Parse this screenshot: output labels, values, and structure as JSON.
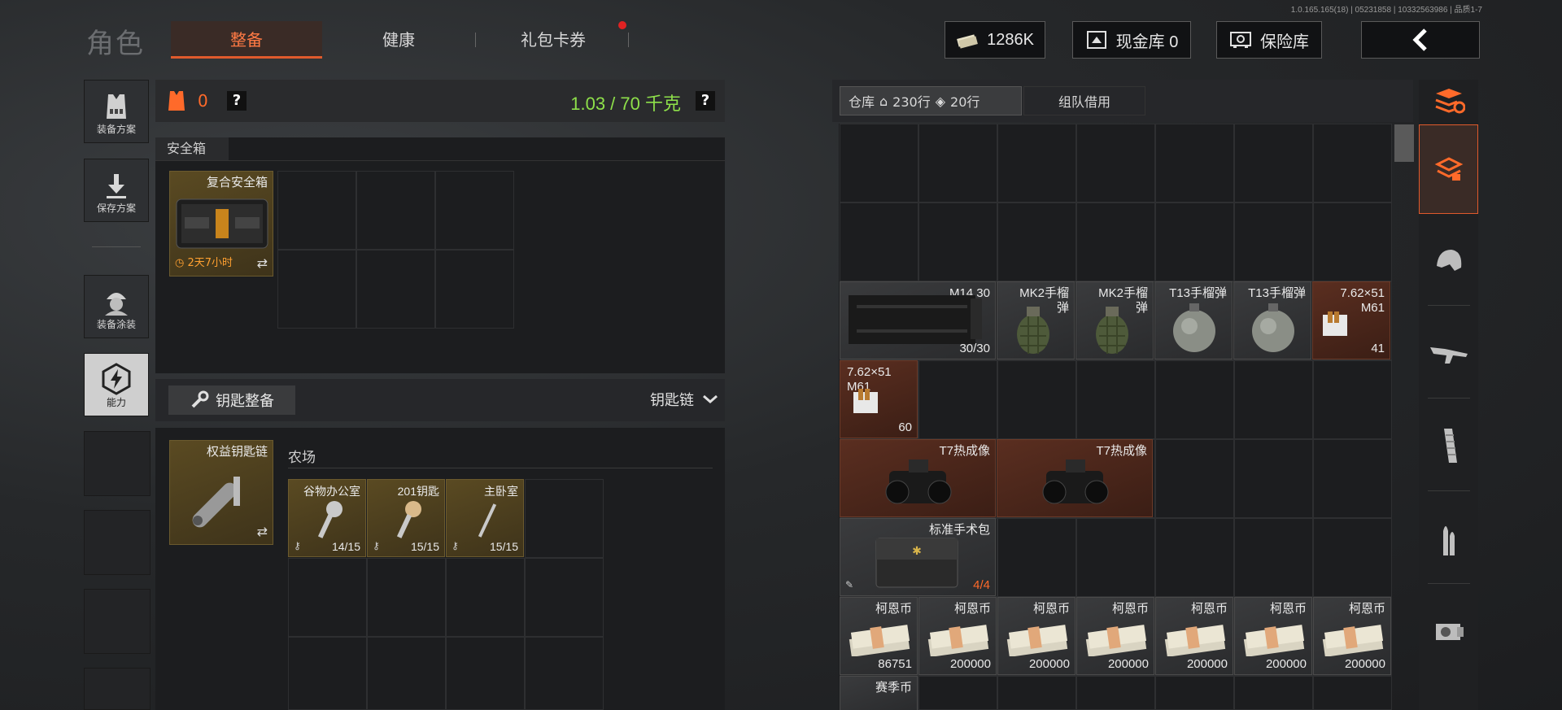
{
  "version": "1.0.165.165(18) | 05231858 | 10332563986 | 品质1-7",
  "header": {
    "title": "角色",
    "tabs": [
      {
        "label": "整备",
        "active": true
      },
      {
        "label": "健康",
        "active": false
      },
      {
        "label": "礼包卡券",
        "active": false,
        "badge": true
      }
    ],
    "money": "1286K",
    "cash_vault": "现金库 0",
    "safe_vault": "保险库"
  },
  "sidebar": {
    "items": [
      {
        "label": "装备方案"
      },
      {
        "label": "保存方案"
      },
      {
        "label": "装备涂装"
      },
      {
        "label": "能力"
      }
    ]
  },
  "loadout": {
    "armor_count": "0",
    "help": "?",
    "weight": "1.03 / 70 千克"
  },
  "safebox": {
    "section_title": "安全箱",
    "item_name": "复合安全箱",
    "timer": "2天7小时"
  },
  "keychain": {
    "button_label": "钥匙整备",
    "dropdown_label": "钥匙链",
    "item_name": "权益钥匙链",
    "area_label": "农场",
    "keys": [
      {
        "name": "谷物办公室",
        "count": "14/15"
      },
      {
        "name": "201钥匙",
        "count": "15/15"
      },
      {
        "name": "主卧室",
        "count": "15/15"
      }
    ]
  },
  "warehouse": {
    "tab_label": "仓库",
    "rows_house": "230行",
    "rows_extra": "20行",
    "team_borrow": "组队借用",
    "items": {
      "m14": {
        "name": "M14 30",
        "count": "30/30"
      },
      "mk2_a": {
        "name": "MK2手榴\n弹"
      },
      "mk2_b": {
        "name": "MK2手榴\n弹"
      },
      "t13_a": {
        "name": "T13手榴弹"
      },
      "t13_b": {
        "name": "T13手榴弹"
      },
      "ammo_a": {
        "name": "7.62×51\nM61",
        "count": "41"
      },
      "ammo_b": {
        "name": "7.62×51\nM61",
        "count": "60"
      },
      "t7_a": {
        "name": "T7热成像"
      },
      "t7_b": {
        "name": "T7热成像"
      },
      "medkit": {
        "name": "标准手术包",
        "count": "4/4"
      },
      "cash": [
        {
          "name": "柯恩币",
          "count": "86751"
        },
        {
          "name": "柯恩币",
          "count": "200000"
        },
        {
          "name": "柯恩币",
          "count": "200000"
        },
        {
          "name": "柯恩币",
          "count": "200000"
        },
        {
          "name": "柯恩币",
          "count": "200000"
        },
        {
          "name": "柯恩币",
          "count": "200000"
        },
        {
          "name": "柯恩币",
          "count": "200000"
        }
      ],
      "next_row": {
        "name": "赛季币"
      }
    }
  }
}
